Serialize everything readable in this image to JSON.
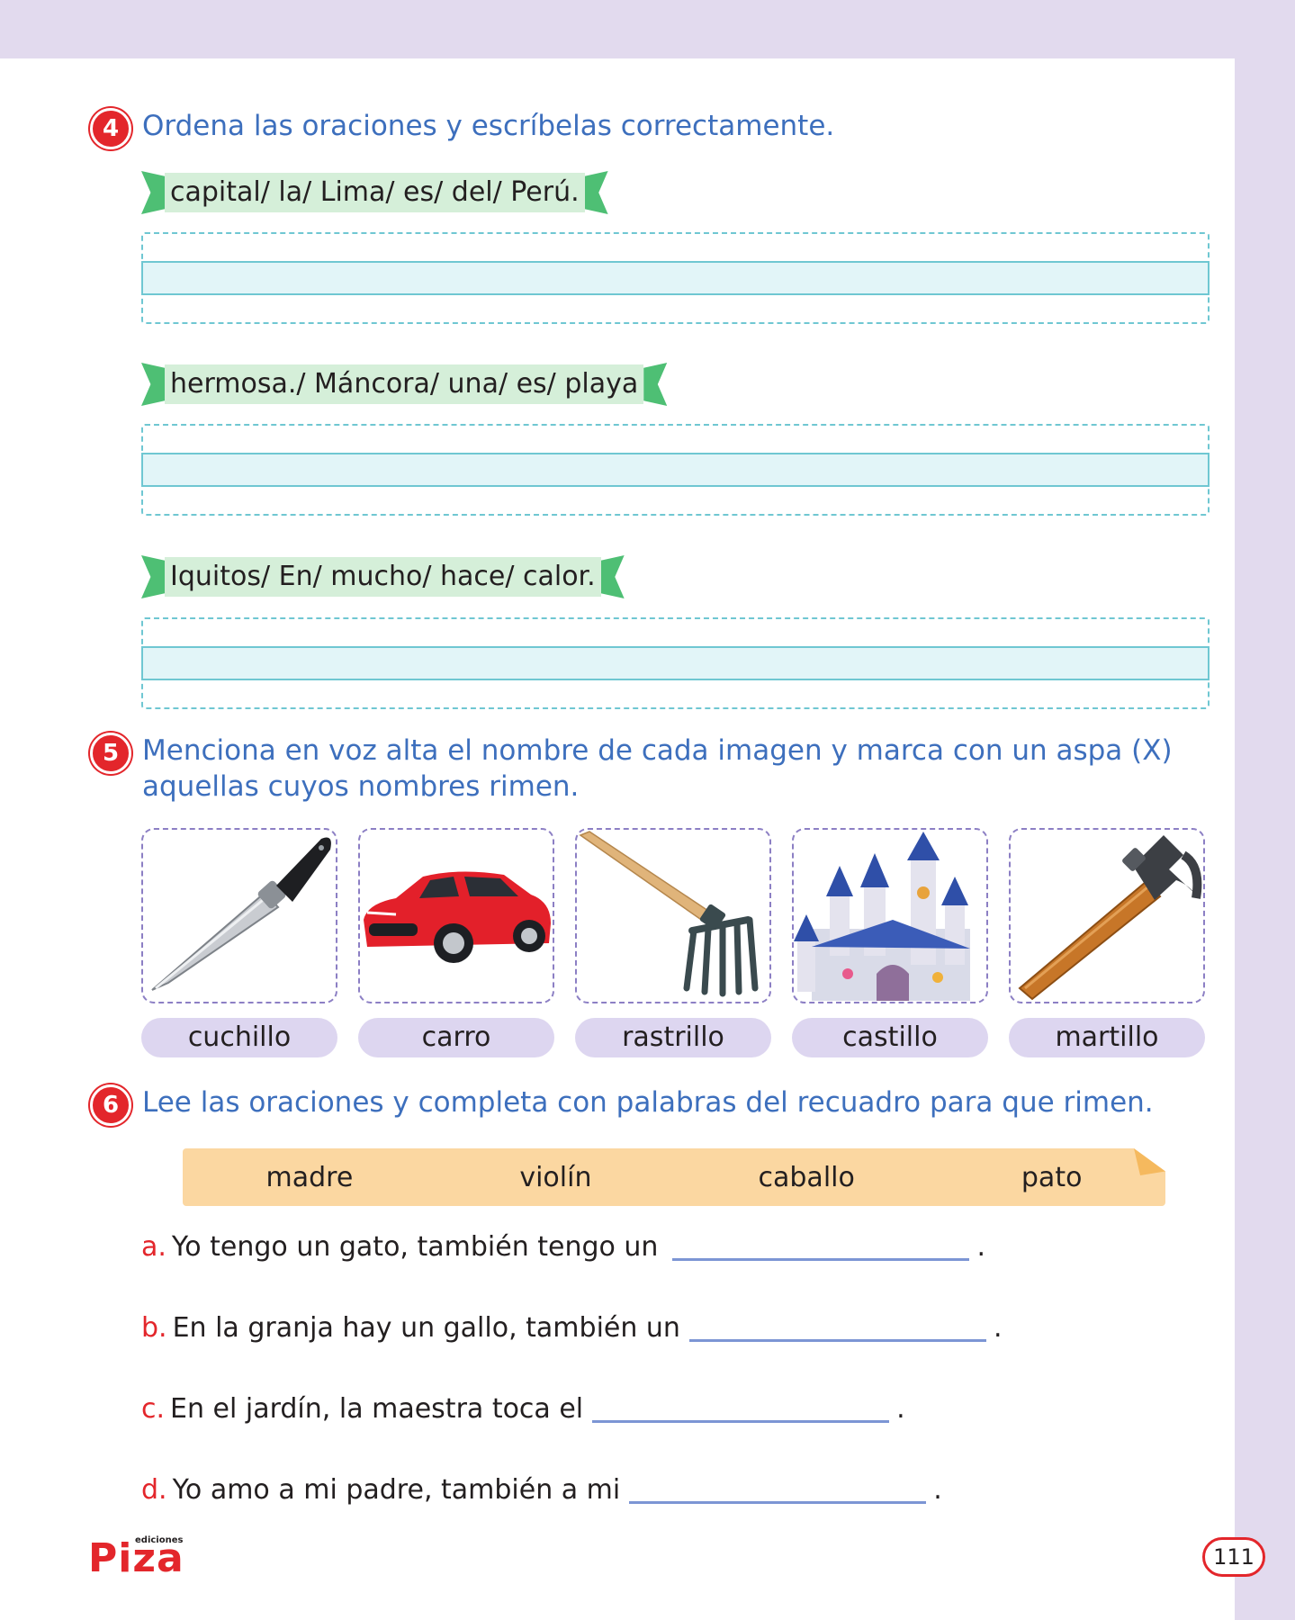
{
  "exercise4": {
    "number": "4",
    "instruction": "Ordena las oraciones y escríbelas correctamente.",
    "sentences": [
      "capital/ la/ Lima/ es/ del/ Perú.",
      "hermosa./ Máncora/ una/ es/ playa",
      "Iquitos/ En/ mucho/ hace/ calor."
    ]
  },
  "exercise5": {
    "number": "5",
    "instruction_line1": "Menciona en voz alta el nombre de cada imagen y marca con un aspa (X)",
    "instruction_line2": "aquellas cuyos nombres rimen.",
    "items": [
      {
        "label": "cuchillo",
        "icon": "knife-icon"
      },
      {
        "label": "carro",
        "icon": "car-icon"
      },
      {
        "label": "rastrillo",
        "icon": "rake-icon"
      },
      {
        "label": "castillo",
        "icon": "castle-icon"
      },
      {
        "label": "martillo",
        "icon": "hammer-icon"
      }
    ]
  },
  "exercise6": {
    "number": "6",
    "instruction": "Lee las oraciones y completa con palabras del recuadro para que rimen.",
    "words": [
      "madre",
      "violín",
      "caballo",
      "pato"
    ],
    "sentences": [
      {
        "letter": "a.",
        "text": "Yo tengo un gato, también tengo un"
      },
      {
        "letter": "b.",
        "text": "En la granja hay un gallo, también un"
      },
      {
        "letter": "c.",
        "text": "En el jardín, la maestra toca el"
      },
      {
        "letter": "d.",
        "text": "Yo amo a mi padre, también a mi"
      }
    ],
    "end_mark": "."
  },
  "footer": {
    "logo_text": "Piza",
    "logo_small": "ediciones",
    "page_number": "111"
  },
  "colors": {
    "accent_red": "#e3262b",
    "instruction_blue": "#3d6fbd",
    "band_lilac": "#e2daee"
  }
}
